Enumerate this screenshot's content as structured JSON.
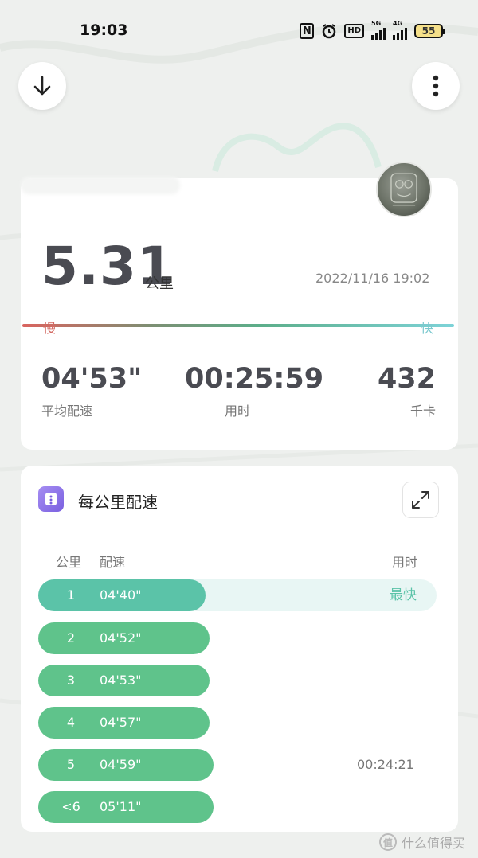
{
  "status_bar": {
    "time": "19:03",
    "nfc_label": "N",
    "hd_label": "HD",
    "sim1_label": "5G",
    "sim2_label": "4G",
    "battery_level": "55",
    "icons": [
      "nfc-icon",
      "alarm-icon",
      "hd-voice-icon",
      "signal-5g-icon",
      "signal-4g-icon",
      "battery-icon"
    ]
  },
  "toolbar": {
    "download_icon": "arrow-down-icon",
    "more_icon": "more-vertical-icon"
  },
  "summary": {
    "distance": "5.31",
    "distance_unit": "公里",
    "datetime": "2022/11/16 19:02",
    "speed_legend": {
      "slow": "慢",
      "fast": "快"
    },
    "stats": [
      {
        "value": "04'53\"",
        "label": "平均配速"
      },
      {
        "value": "00:25:59",
        "label": "用时"
      },
      {
        "value": "432",
        "label": "千卡"
      }
    ]
  },
  "splits": {
    "title": "每公里配速",
    "columns": {
      "km": "公里",
      "pace": "配速",
      "time": "用时"
    },
    "rows": [
      {
        "km": "1",
        "pace": "04'40\"",
        "note": "最快",
        "fill": 0.42,
        "fastest": true
      },
      {
        "km": "2",
        "pace": "04'52\"",
        "note": "",
        "fill": 0.43,
        "fastest": false
      },
      {
        "km": "3",
        "pace": "04'53\"",
        "note": "",
        "fill": 0.43,
        "fastest": false
      },
      {
        "km": "4",
        "pace": "04'57\"",
        "note": "",
        "fill": 0.43,
        "fastest": false
      },
      {
        "km": "5",
        "pace": "04'59\"",
        "note": "00:24:21",
        "fill": 0.44,
        "fastest": false
      },
      {
        "km": "<6",
        "pace": "05'11\"",
        "note": "",
        "fill": 0.44,
        "fastest": false
      }
    ]
  },
  "watermark": {
    "symbol": "值",
    "text": "什么值得买"
  },
  "colors": {
    "pill_green": "#5fc38b",
    "pill_fastest": "#5bc3a8",
    "slow_red": "#d9645f",
    "fast_cyan": "#7dd3d8",
    "accent_purple": "#7a60e0"
  }
}
